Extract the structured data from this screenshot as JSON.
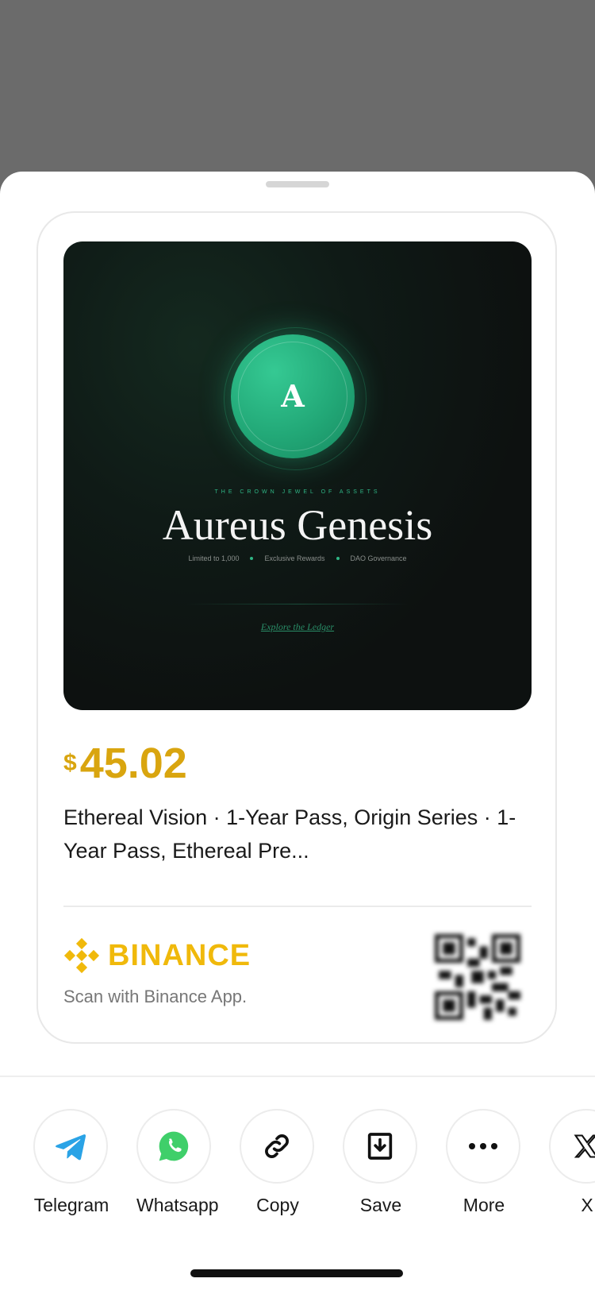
{
  "banner": {
    "coin_letter": "A",
    "tagline": "THE CROWN JEWEL OF ASSETS",
    "title": "Aureus Genesis",
    "features": [
      "Limited to 1,000",
      "Exclusive Rewards",
      "DAO Governance"
    ],
    "link": "Explore the Ledger"
  },
  "product": {
    "currency": "$",
    "price": "45.02",
    "description": "Ethereal Vision · 1-Year Pass, Origin Series · 1-Year Pass, Ethereal Pre..."
  },
  "payment": {
    "brand": "BINANCE",
    "hint": "Scan with Binance App.",
    "brand_color": "#f0b90b"
  },
  "share_options": [
    {
      "label": "Telegram",
      "icon": "telegram-icon"
    },
    {
      "label": "Whatsapp",
      "icon": "whatsapp-icon"
    },
    {
      "label": "Copy",
      "icon": "link-icon"
    },
    {
      "label": "Save",
      "icon": "download-icon"
    },
    {
      "label": "More",
      "icon": "more-icon"
    },
    {
      "label": "X",
      "icon": "x-icon"
    }
  ],
  "colors": {
    "price": "#d9a50f",
    "accent_green": "#2fb585"
  }
}
